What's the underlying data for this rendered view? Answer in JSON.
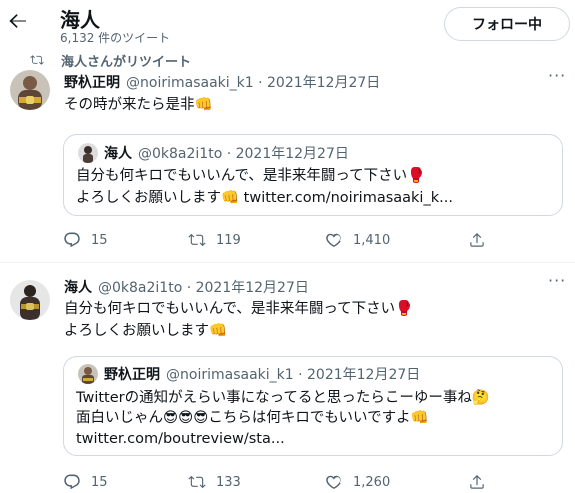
{
  "header": {
    "title": "海人",
    "tweet_count": "6,132 件のツイート",
    "follow_button": "フォロー中"
  },
  "retweet_banner": "海人さんがリツイート",
  "tweet1": {
    "name": "野杁正明",
    "handle_date": "@noirimasaaki_k1 · 2021年12月27日",
    "text": "その時が来たら是非👊",
    "quote": {
      "name": "海人",
      "handle_date": "@0k8a2i1to · 2021年12月27日",
      "line1": "自分も何キロでもいいんで、是非来年闘って下さい🥊",
      "line2": "よろしくお願いします👊 twitter.com/noirimasaaki_k..."
    },
    "replies": "15",
    "retweets": "119",
    "likes": "1,410"
  },
  "tweet2": {
    "name": "海人",
    "handle_date": "@0k8a2i1to · 2021年12月27日",
    "line1": "自分も何キロでもいいんで、是非来年闘って下さい🥊",
    "line2": "よろしくお願いします👊",
    "quote": {
      "name": "野杁正明",
      "handle_date": "@noirimasaaki_k1 · 2021年12月27日",
      "line1": "Twitterの通知がえらい事になってると思ったらこーゆー事ね🤔",
      "line2": "面白いじゃん😎😎😎こちらは何キロでもいいですよ👊",
      "line3": "twitter.com/boutreview/sta..."
    },
    "replies": "15",
    "retweets": "133",
    "likes": "1,260"
  },
  "icons": [
    "back-arrow-icon",
    "retweet-icon",
    "reply-icon",
    "like-icon",
    "share-icon",
    "more-icon"
  ],
  "colors": {
    "text": "#0f1419",
    "secondary": "#536471",
    "border": "#cfd9de"
  }
}
